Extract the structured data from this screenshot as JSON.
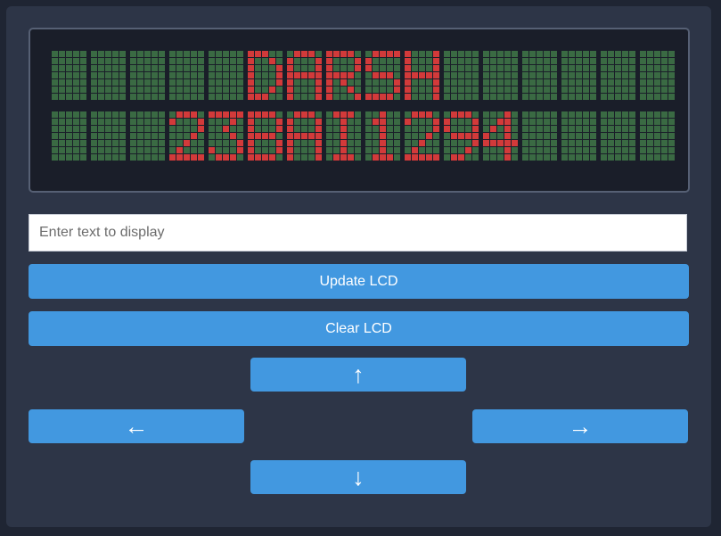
{
  "lcd": {
    "columns": 16,
    "lines": [
      "     DARSH",
      "   23BAI1294"
    ],
    "colors": {
      "pixel_on": "#d23a3a",
      "pixel_off": "#3a6a43",
      "background": "#1a1e29"
    }
  },
  "input": {
    "placeholder": "Enter text to display",
    "value": ""
  },
  "buttons": {
    "update": "Update LCD",
    "clear": "Clear LCD",
    "up": "↑",
    "left": "←",
    "right": "→",
    "down": "↓"
  },
  "colors": {
    "button": "#4298e0",
    "panel": "#2d3547",
    "page": "#1f2533"
  }
}
